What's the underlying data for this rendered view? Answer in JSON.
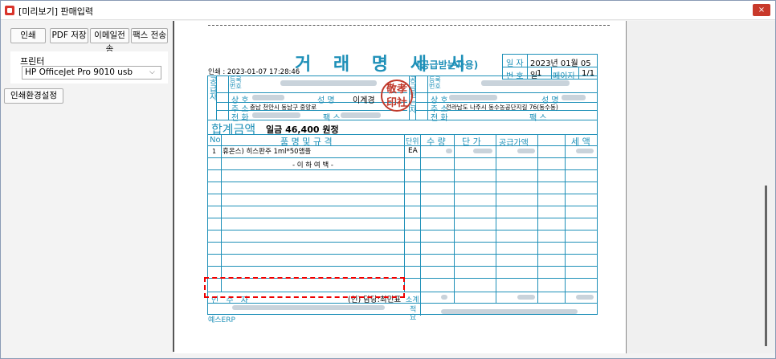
{
  "window": {
    "title": "[미리보기] 판매입력",
    "close_label": "×"
  },
  "toolbar": {
    "print_label": "인쇄",
    "pdf_label": "PDF 저장",
    "email_label": "이메일전송",
    "fax_label": "팩스 전송"
  },
  "printer": {
    "label": "프린터",
    "selected": "HP OfficeJet Pro 9010 usb"
  },
  "settings_label": "인쇄환경설정",
  "doc": {
    "title": "거 래 명 세 서",
    "subtitle": "(공급받는자용)",
    "printed_at": "인쇄 : 2023-01-07 17:28:46",
    "date_label": "일 자",
    "date_value": "2023년 01월 05일",
    "number_label": "번 호",
    "number_value": "1",
    "page_label": "페이지",
    "page_value": "1/1",
    "supplier_side": "공\n급\n자",
    "receiver_side": "공\n급\n받\n는\n자",
    "reg_label": "등록\n번호",
    "name_label": "상 호",
    "rep_label": "성 명",
    "rep_value": "이계경",
    "addr_label": "주 소",
    "supplier_addr": "충남 천안시 동남구 중앙로",
    "receiver_addr": "전라남도 나주시 동수농공단지길 76(동수동)",
    "tel_label": "전 화",
    "fax_label": "팩 스",
    "stamp_text": "敬孝\n印社",
    "total_label": "합계금액",
    "total_value": "일금 46,400 원정",
    "col_no": "No",
    "col_item": "품 명  및  규 격",
    "col_unit": "단위",
    "col_qty": "수 량",
    "col_price": "단 가",
    "col_supply": "공급가액",
    "col_tax": "세 액",
    "row1_no": "1",
    "row1_item": "휴온스) 히스판주 1ml*50앰플",
    "row1_unit": "EA",
    "blank_note": "- 이 하 여 백 -",
    "receiver_sig": "인  수  자",
    "seal_contact": "(인) 담당:최민표",
    "subtotal_label": "소계",
    "remark_label": "적\n요",
    "footer_company": "예스ERP"
  }
}
